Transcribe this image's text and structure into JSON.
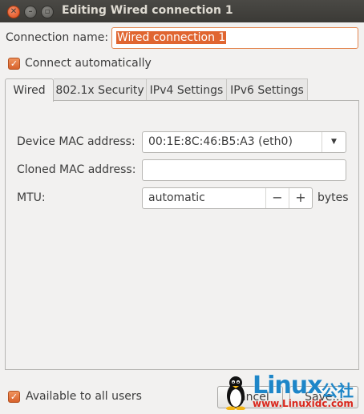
{
  "window": {
    "title": "Editing Wired connection 1"
  },
  "form": {
    "connection_name_label": "Connection name:",
    "connection_name_value": "Wired connection 1",
    "connect_automatically_label": "Connect automatically",
    "connect_automatically_checked": true
  },
  "tabs": [
    {
      "label": "Wired",
      "active": true
    },
    {
      "label": "802.1x Security",
      "active": false
    },
    {
      "label": "IPv4 Settings",
      "active": false
    },
    {
      "label": "IPv6 Settings",
      "active": false
    }
  ],
  "wired": {
    "device_mac_label": "Device MAC address:",
    "device_mac_value": "00:1E:8C:46:B5:A3 (eth0)",
    "cloned_mac_label": "Cloned MAC address:",
    "cloned_mac_value": "",
    "mtu_label": "MTU:",
    "mtu_value": "automatic",
    "mtu_minus": "−",
    "mtu_plus": "+",
    "mtu_unit": "bytes"
  },
  "footer": {
    "available_all_users_label": "Available to all users",
    "available_all_users_checked": true,
    "cancel_label": "Cancel",
    "save_label": "Save..."
  },
  "watermark": {
    "logo": "Linux",
    "logo_cn": "公社",
    "url": "www.Linuxidc.com"
  },
  "colors": {
    "accent": "#e06530",
    "titlebar": "#3c3b37",
    "watermark_blue": "#1e86c8",
    "watermark_red": "#d9271c"
  }
}
